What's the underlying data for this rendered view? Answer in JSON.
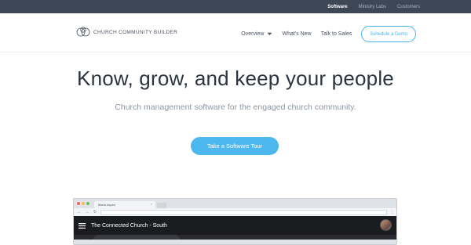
{
  "topbar": {
    "links": [
      {
        "label": "Software",
        "active": true
      },
      {
        "label": "Ministry Labs",
        "active": false
      },
      {
        "label": "Customers",
        "active": false
      }
    ]
  },
  "header": {
    "logo_text": "CHURCH COMMUNITY BUILDER",
    "nav": {
      "overview_label": "Overview",
      "whats_new_label": "What's New",
      "talk_to_sales_label": "Talk to Sales",
      "demo_button_label": "Schedule a Demo"
    }
  },
  "hero": {
    "title": "Know, grow, and keep your people",
    "subtitle": "Church management software for the engaged church community.",
    "cta_label": "Take a Software Tour"
  },
  "browser_preview": {
    "tab_title": "Maria Aspen",
    "tab_close": "×",
    "back_icon": "←",
    "forward_icon": "→",
    "reload_icon": "↻",
    "kebab": "⋮",
    "app_title": "The Connected Church - South"
  },
  "colors": {
    "accent": "#48b3ea",
    "topbar_bg": "#3e4756",
    "title_text": "#2c3440"
  }
}
